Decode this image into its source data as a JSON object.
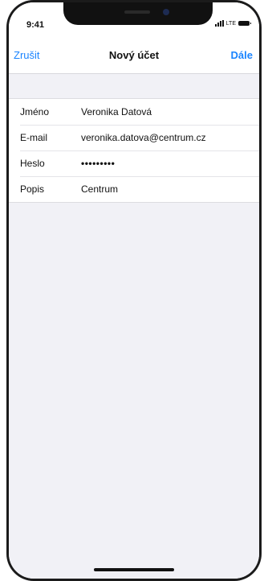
{
  "status_bar": {
    "time": "9:41",
    "network": "LTE"
  },
  "navbar": {
    "cancel_label": "Zrušit",
    "title": "Nový účet",
    "next_label": "Dále"
  },
  "form": {
    "rows": [
      {
        "label": "Jméno",
        "value": "Veronika Datová"
      },
      {
        "label": "E-mail",
        "value": "veronika.datova@centrum.cz"
      },
      {
        "label": "Heslo",
        "value": "•••••••••"
      },
      {
        "label": "Popis",
        "value": "Centrum"
      }
    ]
  },
  "colors": {
    "accent": "#1a84ff",
    "background": "#f1f1f6",
    "surface": "#ffffff"
  }
}
